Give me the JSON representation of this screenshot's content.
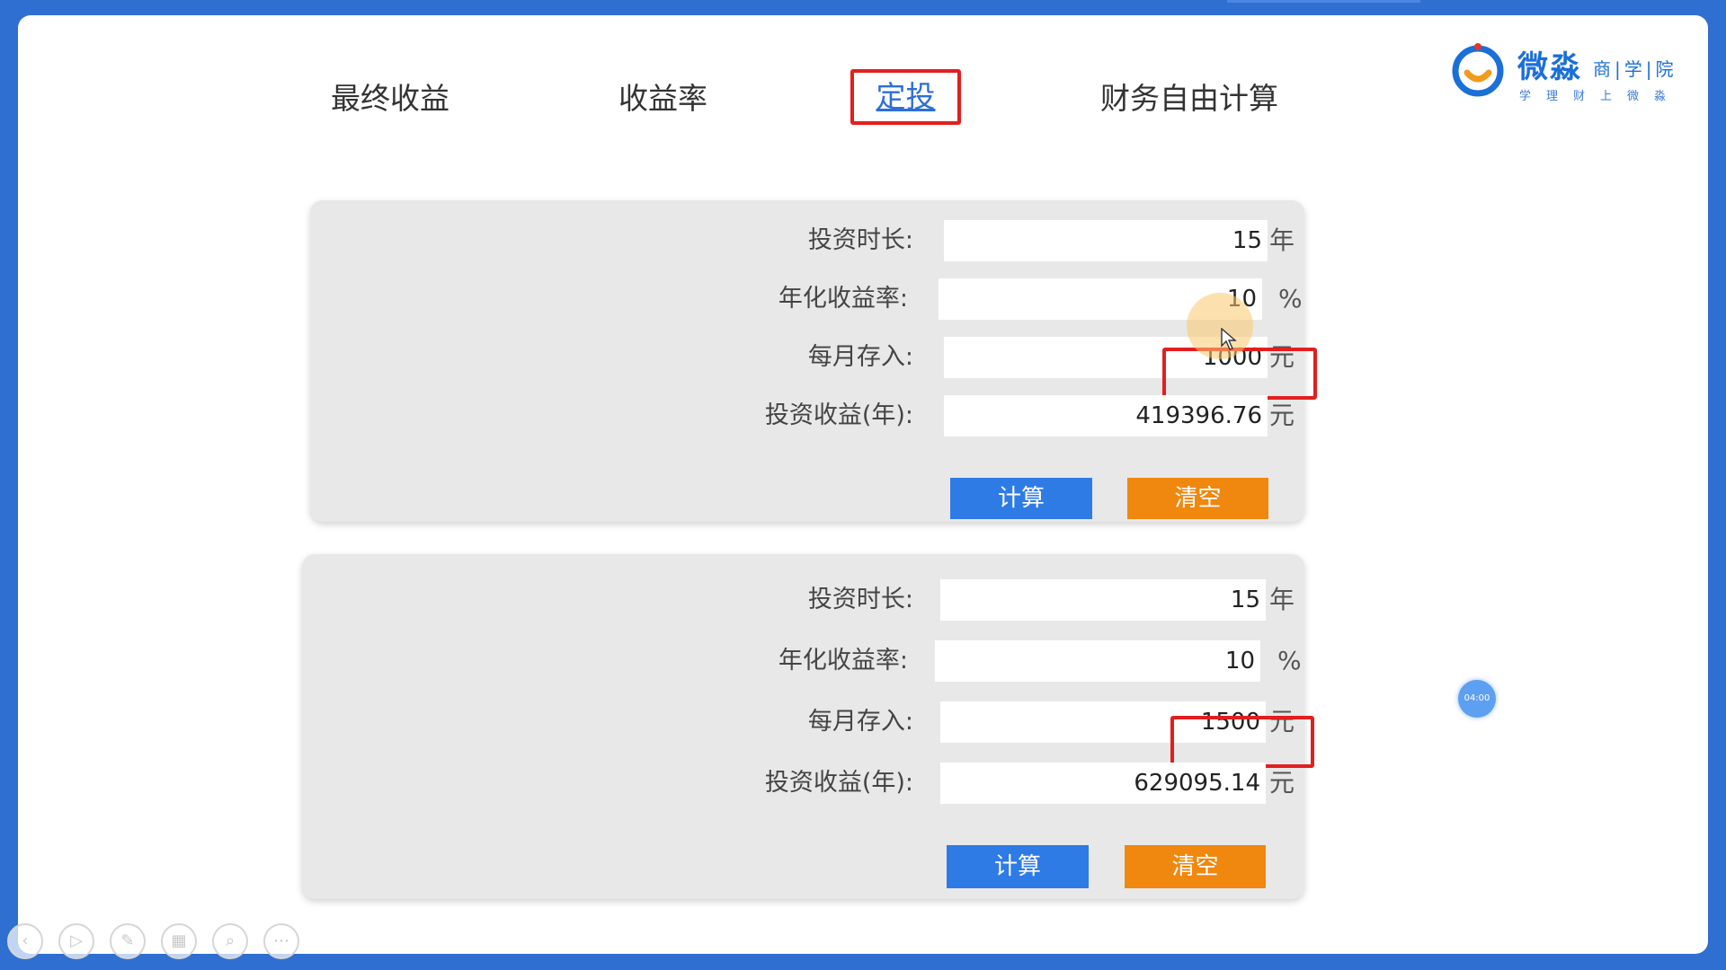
{
  "logo": {
    "main": "微淼",
    "sub": "商|学|院",
    "slogan": "学理财上微淼"
  },
  "tabs": [
    {
      "label": "最终收益"
    },
    {
      "label": "收益率"
    },
    {
      "label": "定投"
    },
    {
      "label": "财务自由计算"
    }
  ],
  "panels": [
    {
      "duration": {
        "label": "投资时长:",
        "value": "15",
        "unit": "年"
      },
      "rate": {
        "label": "年化收益率:",
        "value": "10",
        "unit": "%"
      },
      "monthly": {
        "label": "每月存入:",
        "value": "1000",
        "unit": "元"
      },
      "income": {
        "label": "投资收益(年):",
        "value": "419396.76",
        "unit": "元"
      },
      "calc_label": "计算",
      "clear_label": "清空"
    },
    {
      "duration": {
        "label": "投资时长:",
        "value": "15",
        "unit": "年"
      },
      "rate": {
        "label": "年化收益率:",
        "value": "10",
        "unit": "%"
      },
      "monthly": {
        "label": "每月存入:",
        "value": "1500",
        "unit": "元"
      },
      "income": {
        "label": "投资收益(年):",
        "value": "629095.14",
        "unit": "元"
      },
      "calc_label": "计算",
      "clear_label": "清空"
    }
  ],
  "timer": "04:00",
  "toolbar": [
    "prev-icon",
    "play-icon",
    "pen-icon",
    "grid-icon",
    "zoom-icon",
    "more-icon"
  ],
  "colors": {
    "accent": "#2e7be6",
    "clear": "#f0870f",
    "highlight": "#e21f1f",
    "frame": "#2f6fd1"
  }
}
